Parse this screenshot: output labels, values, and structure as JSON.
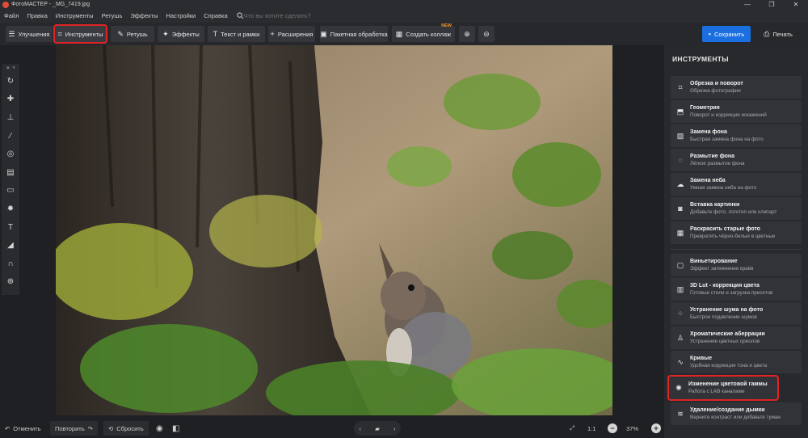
{
  "window": {
    "title": "ФотоМАСТЕР - _MG_7419.jpg",
    "controls": [
      "—",
      "❐",
      "✕"
    ]
  },
  "menu": {
    "items": [
      "Файл",
      "Правка",
      "Инструменты",
      "Ретушь",
      "Эффекты",
      "Настройки",
      "Справка"
    ],
    "search_placeholder": "Что вы хотите сделать?"
  },
  "toolbar": {
    "tabs": [
      {
        "label": "Улучшения",
        "icon": "sliders-icon"
      },
      {
        "label": "Инструменты",
        "icon": "crop-icon",
        "active": true
      },
      {
        "label": "Ретушь",
        "icon": "brush-icon"
      },
      {
        "label": "Эффекты",
        "icon": "sparkle-icon"
      },
      {
        "label": "Текст и рамки",
        "icon": "text-icon"
      },
      {
        "label": "Расширения",
        "icon": "plus-icon"
      }
    ],
    "batch_label": "Пакетная обработка",
    "collage_label": "Создать коллаж",
    "collage_badge": "NEW",
    "save_label": "Сохранить",
    "print_label": "Печать"
  },
  "bottom": {
    "undo_label": "Отменить",
    "redo_label": "Повторить",
    "reset_label": "Сбросить",
    "ratio_label": "1:1",
    "zoom_value": "37%"
  },
  "panel": {
    "title": "ИНСТРУМЕНТЫ",
    "group1": [
      {
        "title": "Обрезка и поворот",
        "sub": "Обрезка фотографии",
        "icon": "crop-icon"
      },
      {
        "title": "Геометрия",
        "sub": "Поворот и коррекция искажений",
        "icon": "geometry-icon"
      },
      {
        "title": "Замена фона",
        "sub": "Быстрая замена фона на фото",
        "icon": "background-replace-icon"
      },
      {
        "title": "Размытие фона",
        "sub": "Лёгкое размытие фона",
        "icon": "blur-icon"
      },
      {
        "title": "Замена неба",
        "sub": "Умная замена неба на фото",
        "icon": "sky-icon"
      },
      {
        "title": "Вставка картинки",
        "sub": "Добавьте фото, логотип или клипарт",
        "icon": "image-insert-icon"
      },
      {
        "title": "Раскрасить старые фото",
        "sub": "Превратить чёрно-белые в цветные",
        "icon": "colorize-icon"
      }
    ],
    "group2": [
      {
        "title": "Виньетирование",
        "sub": "Эффект затемнения краёв",
        "icon": "vignette-icon"
      },
      {
        "title": "3D Lut - коррекция цвета",
        "sub": "Готовые стили и загрузка пресетов",
        "icon": "lut-icon"
      },
      {
        "title": "Устранение шума на фото",
        "sub": "Быстрое подавление шумов",
        "icon": "noise-icon"
      },
      {
        "title": "Хроматические аберрации",
        "sub": "Устранение цветных ореолов",
        "icon": "aberration-icon"
      },
      {
        "title": "Кривые",
        "sub": "Удобная коррекция тона и цвета",
        "icon": "curves-icon"
      },
      {
        "title": "Изменение цветовой гаммы",
        "sub": "Работа с LAB каналами",
        "icon": "color-wheel-icon",
        "highlighted": true
      },
      {
        "title": "Удаление/создание дымки",
        "sub": "Верните контраст или добавьте туман",
        "icon": "haze-icon"
      }
    ]
  },
  "left_tools": [
    "rotate-icon",
    "patch-icon",
    "stamp-icon",
    "brush-icon",
    "target-icon",
    "gradient-icon",
    "rect-icon",
    "sun-icon",
    "text-icon",
    "fill-icon",
    "magnet-icon",
    "globe-icon"
  ],
  "colors": {
    "accent": "#1b6fe0",
    "highlight": "#e02424",
    "badge": "#f59a23",
    "panel_bg": "#28292d"
  }
}
